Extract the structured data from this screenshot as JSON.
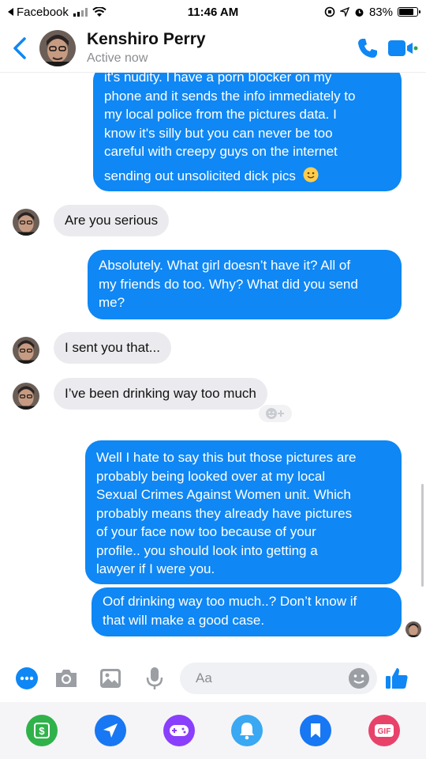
{
  "status_bar": {
    "back_app": "Facebook",
    "time": "11:46 AM",
    "battery": "83%",
    "battery_level": 0.83
  },
  "header": {
    "contact_name": "Kenshiro Perry",
    "status": "Active now"
  },
  "messages": [
    {
      "from": "me",
      "lines": [
        "it's nudity. I have a porn blocker on my",
        "phone and it sends the info immediately to",
        "my local police from the pictures data. I",
        "know it's silly but you can never be too",
        "careful with creepy guys on the internet",
        "sending out unsolicited dick pics"
      ],
      "emoji": "slightly-smiling-face"
    },
    {
      "from": "them",
      "text": "Are you serious"
    },
    {
      "from": "me",
      "lines": [
        "Absolutely. What girl doesn’t have it? All of",
        "my friends do too. Why? What did you send",
        "me?"
      ]
    },
    {
      "from": "them",
      "text": "I sent you that..."
    },
    {
      "from": "them",
      "text": "I’ve been drinking way too much"
    },
    {
      "from": "me",
      "lines": [
        "Well I hate to say this but those pictures are",
        "probably being looked over at my local",
        "Sexual Crimes Against Women unit. Which",
        "probably means they already have pictures",
        "of your face now too because of your",
        "profile.. you should look into getting a",
        "lawyer if I were you."
      ]
    },
    {
      "from": "me",
      "lines": [
        "Oof drinking way too much..? Don’t know if",
        "that will make a good case."
      ]
    }
  ],
  "composer": {
    "placeholder": "Aa"
  },
  "icons": {
    "composer": [
      "more-icon",
      "camera-icon",
      "gallery-icon",
      "microphone-icon",
      "emoji-icon",
      "like-icon"
    ],
    "drawer": [
      "payment-icon",
      "location-icon",
      "games-icon",
      "reminder-icon",
      "bookmark-icon",
      "gif-icon"
    ]
  },
  "colors": {
    "accent": "#0f87f4",
    "incoming_bubble": "#ebebef"
  }
}
